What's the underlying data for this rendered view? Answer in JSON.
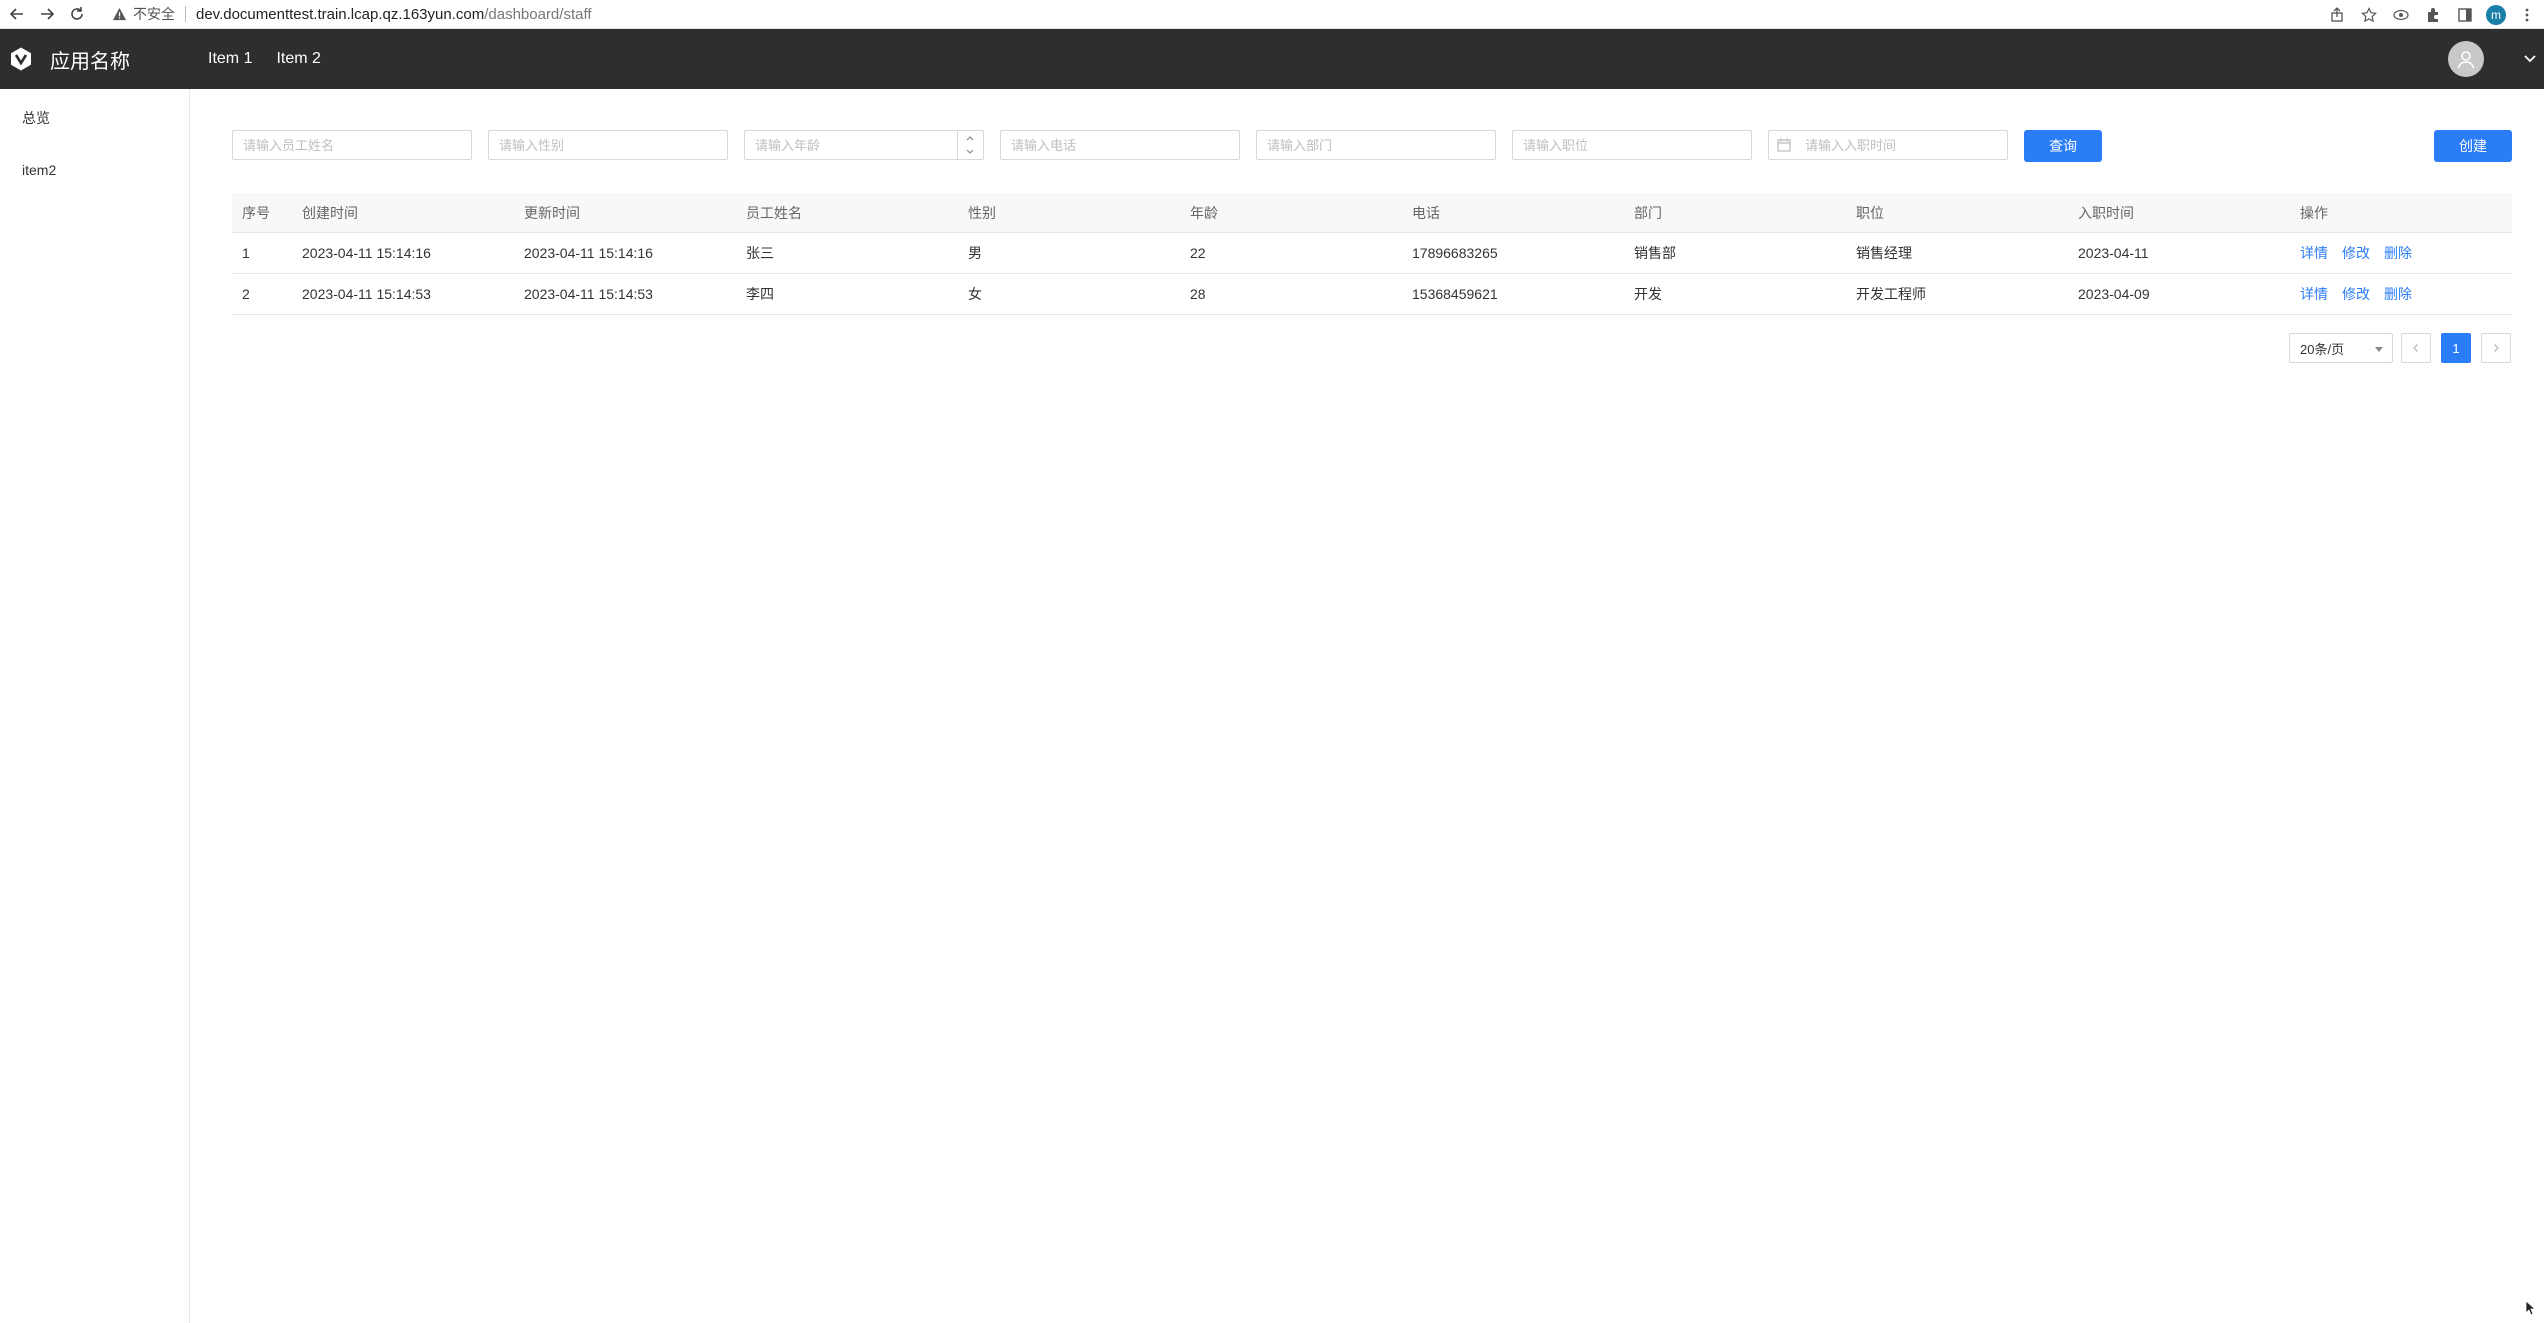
{
  "browser": {
    "security_label": "不安全",
    "url_host": "dev.documenttest.train.lcap.qz.163yun.com",
    "url_path": "/dashboard/staff",
    "profile_initial": "m"
  },
  "header": {
    "app_name": "应用名称",
    "nav": [
      "Item 1",
      "Item 2"
    ]
  },
  "sidebar": {
    "items": [
      {
        "label": "总览"
      },
      {
        "label": "item2"
      }
    ]
  },
  "filters": {
    "name_placeholder": "请输入员工姓名",
    "gender_placeholder": "请输入性别",
    "age_placeholder": "请输入年龄",
    "phone_placeholder": "请输入电话",
    "dept_placeholder": "请输入部门",
    "position_placeholder": "请输入职位",
    "hire_date_placeholder": "请输入入职时间",
    "query_label": "查询",
    "create_label": "创建"
  },
  "table": {
    "columns": [
      "序号",
      "创建时间",
      "更新时间",
      "员工姓名",
      "性别",
      "年龄",
      "电话",
      "部门",
      "职位",
      "入职时间",
      "操作"
    ],
    "rows": [
      {
        "idx": "1",
        "created": "2023-04-11 15:14:16",
        "updated": "2023-04-11 15:14:16",
        "name": "张三",
        "gender": "男",
        "age": "22",
        "phone": "17896683265",
        "dept": "销售部",
        "position": "销售经理",
        "hire_date": "2023-04-11"
      },
      {
        "idx": "2",
        "created": "2023-04-11 15:14:53",
        "updated": "2023-04-11 15:14:53",
        "name": "李四",
        "gender": "女",
        "age": "28",
        "phone": "15368459621",
        "dept": "开发",
        "position": "开发工程师",
        "hire_date": "2023-04-09"
      }
    ],
    "actions": {
      "detail": "详情",
      "edit": "修改",
      "delete": "删除"
    }
  },
  "pagination": {
    "page_size": "20条/页",
    "current_page": "1"
  },
  "colors": {
    "header_bg": "#2e2e2e",
    "primary": "#2b7df7"
  }
}
